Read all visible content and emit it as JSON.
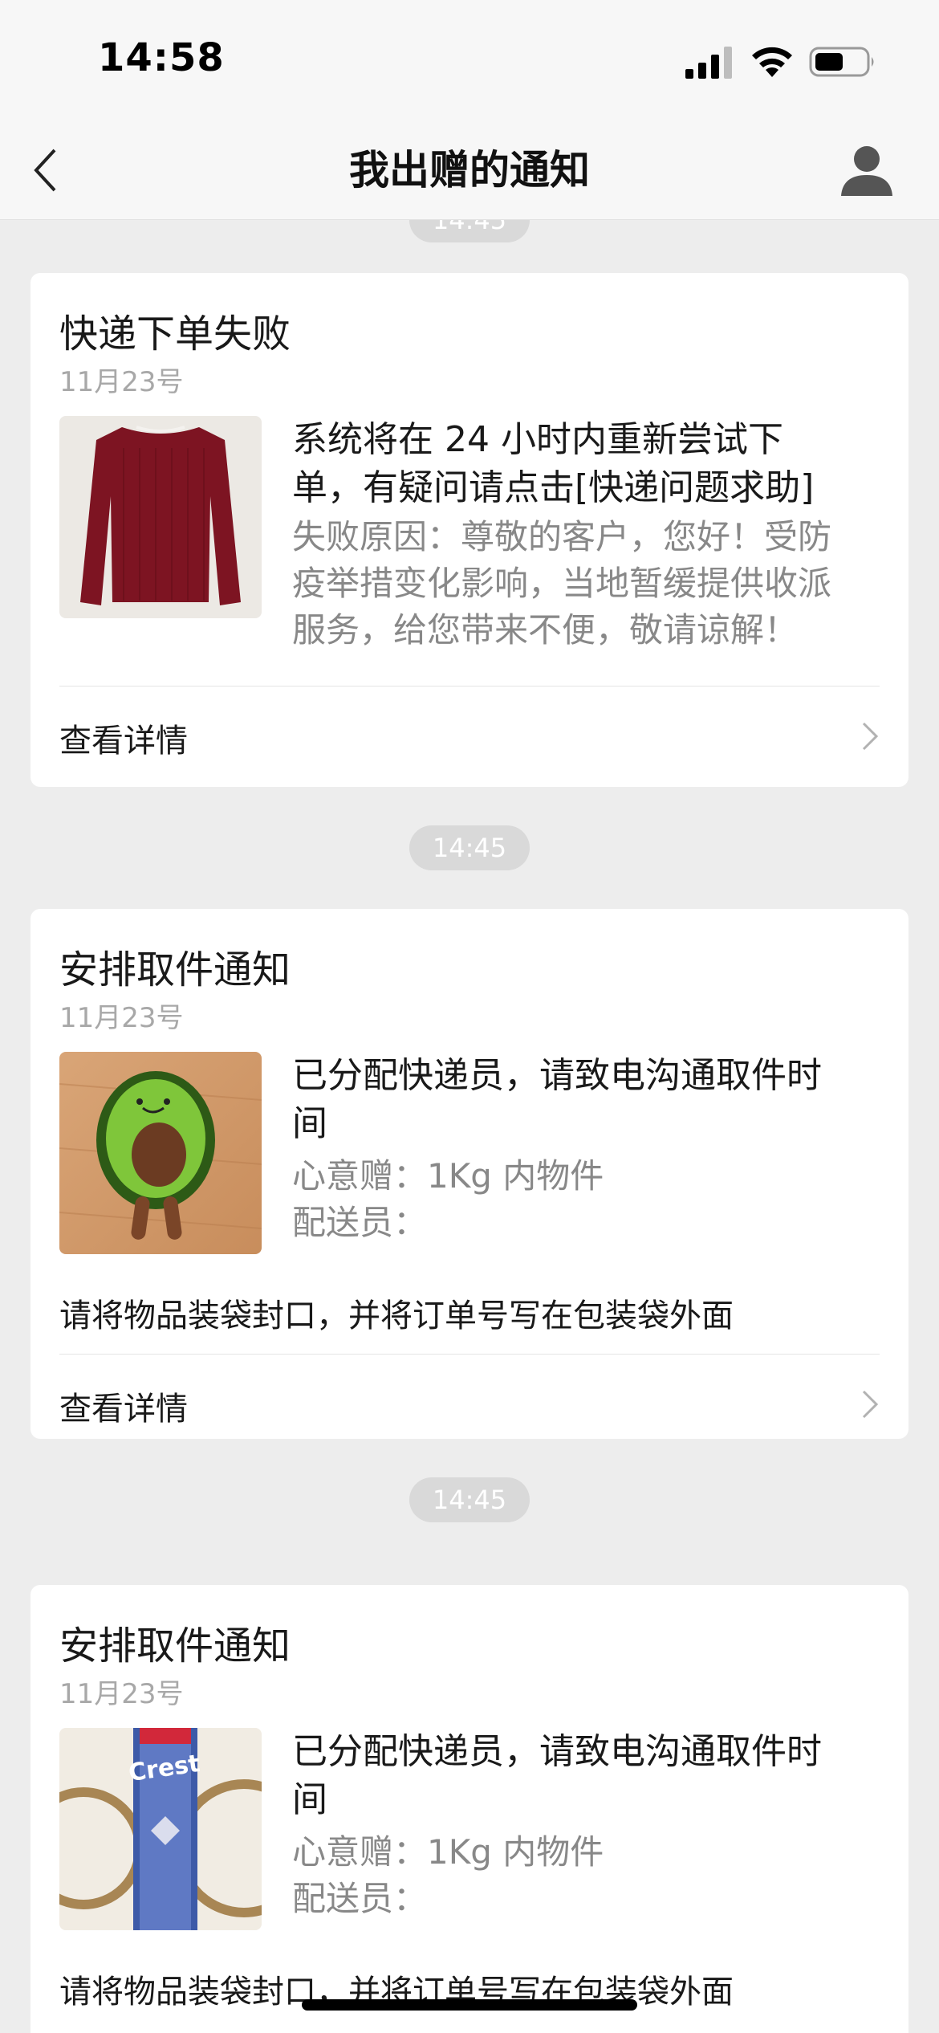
{
  "status_bar": {
    "time": "14:58"
  },
  "nav": {
    "title": "我出赠的通知",
    "back_icon": "chevron-left-icon",
    "profile_icon": "user-icon"
  },
  "top_timestamp_partial": "14:45",
  "notifications": [
    {
      "title": "快递下单失败",
      "date": "11月23号",
      "thumbnail": "red-sweater-photo",
      "message_lines": [
        "系统将在 24 小时内重新尝试下",
        "单，有疑问请点击[快递问题求助]"
      ],
      "sub_lines": [
        "失败原因：尊敬的客户，您好！受防",
        "疫举措变化影响，当地暂缓提供收派",
        "服务，给您带来不便，敬请谅解！"
      ],
      "detail_label": "查看详情"
    },
    {
      "timestamp": "14:45",
      "title": "安排取件通知",
      "date": "11月23号",
      "thumbnail": "avocado-plush-photo",
      "message_lines": [
        "已分配快递员，请致电沟通取件时",
        "间"
      ],
      "sub_lines": [
        "心意赠：1Kg 内物件",
        "配送员："
      ],
      "note": "请将物品装袋封口，并将订单号写在包装袋外面",
      "detail_label": "查看详情"
    },
    {
      "timestamp": "14:45",
      "title": "安排取件通知",
      "date": "11月23号",
      "thumbnail": "toothpaste-photo",
      "message_lines": [
        "已分配快递员，请致电沟通取件时",
        "间"
      ],
      "sub_lines": [
        "心意赠：1Kg 内物件",
        "配送员："
      ],
      "note": "请将物品装袋封口，并将订单号写在包装袋外面"
    }
  ]
}
